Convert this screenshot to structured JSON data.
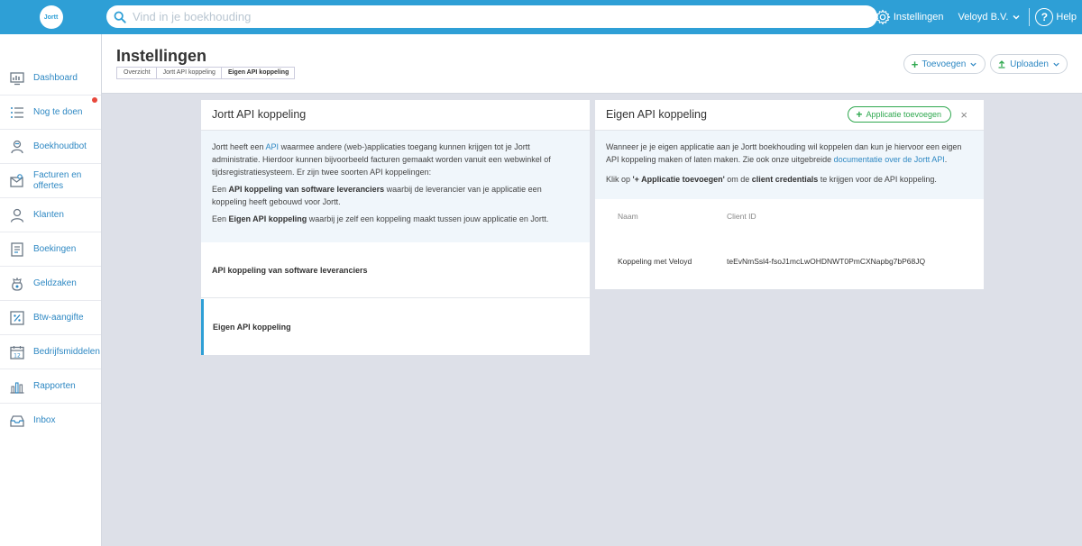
{
  "topbar": {
    "logo_text": "Jortt",
    "search_placeholder": "Vind in je boekhouding",
    "settings_label": "Instellingen",
    "company_label": "Veloyd B.V.",
    "help_label": "Help",
    "help_glyph": "?"
  },
  "sidebar": {
    "items": [
      {
        "label": "Dashboard",
        "icon": "dashboard-icon"
      },
      {
        "label": "Nog te doen",
        "icon": "list-icon"
      },
      {
        "label": "Boekhoudbot",
        "icon": "bot-icon"
      },
      {
        "label": "Facturen en offertes",
        "icon": "invoice-icon"
      },
      {
        "label": "Klanten",
        "icon": "customer-icon"
      },
      {
        "label": "Boekingen",
        "icon": "bookings-icon"
      },
      {
        "label": "Geldzaken",
        "icon": "money-icon"
      },
      {
        "label": "Btw-aangifte",
        "icon": "percent-icon"
      },
      {
        "label": "Bedrijfsmiddelen",
        "icon": "calendar-icon"
      },
      {
        "label": "Rapporten",
        "icon": "chart-icon"
      },
      {
        "label": "Inbox",
        "icon": "inbox-icon"
      }
    ]
  },
  "header": {
    "title": "Instellingen",
    "breadcrumbs": [
      "Overzicht",
      "Jortt API koppeling",
      "Eigen API koppeling"
    ],
    "add_label": "Toevoegen",
    "upload_label": "Uploaden"
  },
  "left_panel": {
    "title": "Jortt API koppeling",
    "info": {
      "p1_a": "Jortt heeft een ",
      "p1_link": "API",
      "p1_b": " waarmee andere (web-)applicaties toegang kunnen krijgen tot je Jortt administratie. Hierdoor kunnen bijvoorbeeld facturen gemaakt worden vanuit een webwinkel of tijdsregistratiesysteem. Er zijn twee soorten API koppelingen:",
      "p2_a": "Een ",
      "p2_bold": "API koppeling van software leveranciers",
      "p2_b": " waarbij de leverancier van je applicatie een koppeling heeft gebouwd voor Jortt.",
      "p3_a": "Een ",
      "p3_bold": "Eigen API koppeling",
      "p3_b": " waarbij je zelf een koppeling maakt tussen jouw applicatie en Jortt."
    },
    "rows": [
      "API koppeling van software leveranciers",
      "Eigen API koppeling"
    ]
  },
  "right_panel": {
    "title": "Eigen API koppeling",
    "add_button": "Applicatie toevoegen",
    "close_glyph": "×",
    "info": {
      "p1_a": "Wanneer je je eigen applicatie aan je Jortt boekhouding wil koppelen dan kun je hiervoor een eigen API koppeling maken of laten maken. Zie ook onze uitgebreide ",
      "p1_link": "documentatie over de Jortt API",
      "p1_b": ".",
      "p2_a": "Klik op ",
      "p2_bold1": "'+ Applicatie toevoegen'",
      "p2_b": " om de ",
      "p2_bold2": "client credentials",
      "p2_c": " te krijgen voor de API koppeling."
    },
    "table": {
      "col_name": "Naam",
      "col_client": "Client ID",
      "rows": [
        {
          "name": "Koppeling met Veloyd",
          "client_id": "teEvNmSsl4-fsoJ1mcLwOHDNWT0PmCXNapbg7bP68JQ"
        }
      ]
    }
  },
  "colors": {
    "accent": "#2e9fd6",
    "link": "#2e88c3",
    "green": "#2fa84f",
    "notification": "#e8483c"
  }
}
